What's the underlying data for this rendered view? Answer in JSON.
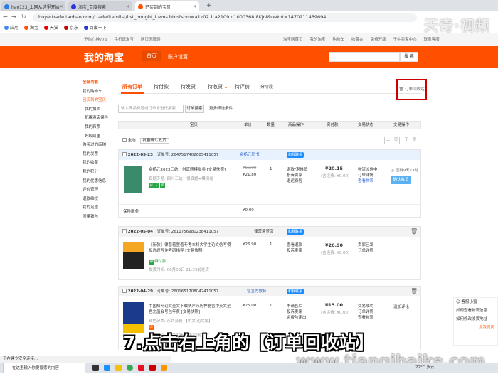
{
  "browser": {
    "tabs": [
      "hao123_上网从这里开始",
      "淘宝_百度搜索",
      "已买到的宝贝"
    ],
    "url": "buyertrade.taobao.com/trade/itemlist/list_bought_items.htm?spm=a1z02.1.a2109.d1000368.8Kjof&nekot=1470211439694",
    "bookmarks": [
      "应用",
      "淘宝",
      "天猫",
      "京东",
      "百度一下"
    ],
    "status": "正在建立安全连接..."
  },
  "watermark": {
    "top": "天奇·视频",
    "bottom": "www.tianqibaike.com"
  },
  "site_nav": {
    "left": [
      "手机淘宝",
      "千牛卖家中心",
      "联系客服"
    ],
    "left_top": [
      "予你心神776",
      "手机逛淘宝",
      "网页无障碍"
    ],
    "right": [
      "淘宝网首页",
      "我的淘宝",
      "购物车",
      "收藏夹",
      "免费开店",
      "千牛卖家中心",
      "联系客服"
    ]
  },
  "header": {
    "title": "我的淘宝",
    "home": "首页",
    "account": "账户设置",
    "search_button": "搜 索"
  },
  "sidebar": {
    "heading": "全部功能",
    "items": [
      "我的购物车",
      "已买到的宝贝",
      "我的拍卖",
      "机票酒店保险",
      "我的彩票",
      "蚂蚁阿里",
      "购买过的店铺",
      "我的发票",
      "我的收藏",
      "我的积分",
      "我的优惠信息",
      "评价管理",
      "退款维权",
      "我的足迹",
      "流量钱包"
    ]
  },
  "order_tabs": [
    "所有订单",
    "待付款",
    "待发货",
    "待收货",
    "待评价",
    "分阶段"
  ],
  "order_tab_badge": "1",
  "recycle": "订单回收站",
  "search": {
    "placeholder": "输入商品标题或订单号进行搜索",
    "button": "订单搜索",
    "more": "更多筛选条件"
  },
  "columns": [
    "宝贝",
    "单价",
    "数量",
    "商品操作",
    "实付款",
    "交易状态",
    "交易操作"
  ],
  "bar": {
    "select_all": "全选",
    "batch": "批量确认收货",
    "prev": "上一页",
    "next": "下一页"
  },
  "orders": [
    {
      "date": "2022-05-23",
      "order_no": "订单号: 2647517402685411057",
      "shop": "金杨元图书",
      "wangwang": "和我联系",
      "title": "金杨元2023三统一供真题模拟卷 [交易快照]",
      "spec": "真题专题: 四川三统一供真题+模拟卷",
      "badges": [
        "正",
        "7",
        "退"
      ],
      "orig_price": "¥50.00",
      "price": "¥21.80",
      "qty": "1",
      "ops": [
        "退款/退换货",
        "投诉卖家",
        "退运费险"
      ],
      "total": "¥20.15",
      "total_note": "(含运费: ¥0.00)",
      "status": [
        "物流派件中",
        "订单详情",
        "查看物流"
      ],
      "remain": "还剩9天23时",
      "confirm": "确认收货",
      "extra_label": "保险服务",
      "extra_price": "¥0.00"
    },
    {
      "date": "2022-05-04",
      "order_no": "订单号: 2611756980238411057",
      "shop": "律营着萱店",
      "wangwang": "和我联系",
      "title": "【新款】律营着萱着专考本科大学生论文仿写模板选题写作考研指导 [交易快照]",
      "spec": "保险单",
      "badges": [
        "中",
        "待付款"
      ],
      "delivery": "发货时间: 06月03日 21:33前发货",
      "price": "¥26.90",
      "qty": "1",
      "ops": [
        "查看退款",
        "投诉卖家"
      ],
      "total": "¥26.90",
      "total_note": "(含运费: ¥0.00)",
      "status": [
        "卖家已发",
        "订单详情"
      ]
    },
    {
      "date": "2022-04-29",
      "order_no": "订单号: 2601651708042411057",
      "shop": "智立方教育",
      "wangwang": "和我联系",
      "title": "中国知网论文查文下载快声万历神器吉中英文全色充值会号包年费 [交易快照]",
      "spec": "颜色分类: 永久会员 【中文 论文版】",
      "badges": [
        "Ⓢ"
      ],
      "delivery": "发货时间: 04月29日 20:32前发货",
      "price": "¥25.00",
      "qty": "1",
      "ops": [
        "申请售后",
        "投诉卖家",
        "运费险定出"
      ],
      "total": "¥15.00",
      "total_note": "(含运费: ¥0.00)",
      "status": [
        "交易成功",
        "订单详情",
        "查看物流"
      ],
      "extra": "追加评论"
    }
  ],
  "help": {
    "title": "客服小蜜",
    "items": [
      "如何查看物流信息",
      "如何修改收货地址",
      "点我提问"
    ]
  },
  "caption": "7.点击右上角的【订单回收站】",
  "taskbar": {
    "search": "在这里输入你要搜索的内容",
    "weather": "22°C 多云",
    "time": "2022"
  },
  "colors": {
    "brand": "#ff5000",
    "highlight": "#cc0000"
  }
}
